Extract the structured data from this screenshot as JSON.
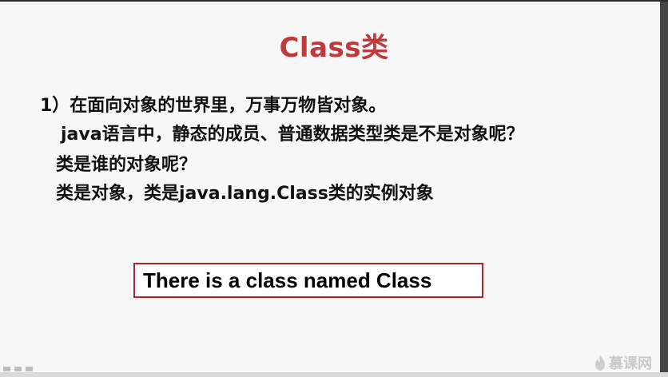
{
  "slide": {
    "title": "Class类",
    "lines": [
      "1）在面向对象的世界里，万事万物皆对象。",
      "java语言中，静态的成员、普通数据类型类是不是对象呢？",
      "类是谁的对象呢？",
      "类是对象，类是java.lang.Class类的实例对象"
    ],
    "boxed_text": "There is a class named Class"
  },
  "watermark": {
    "text": "慕课网",
    "icon": "flame-icon"
  },
  "player_controls": {
    "icons": [
      "prev-icon",
      "pause-icon",
      "next-icon"
    ]
  },
  "colors": {
    "title": "#c0393b",
    "box_border": "#b0232a",
    "background": "#f7f7f7"
  }
}
